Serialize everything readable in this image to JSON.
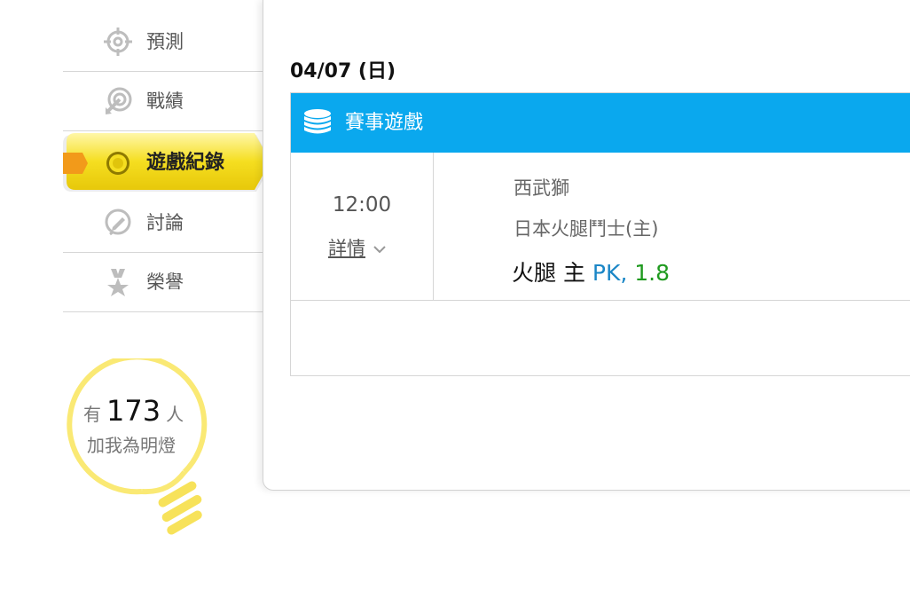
{
  "nav": {
    "items": [
      {
        "label": "預測",
        "icon": "crosshair-icon"
      },
      {
        "label": "戰績",
        "icon": "target-arrow-icon"
      },
      {
        "label": "遊戲紀錄",
        "icon": "ring-icon",
        "active": true
      },
      {
        "label": "討論",
        "icon": "chat-pencil-icon"
      },
      {
        "label": "榮譽",
        "icon": "medal-star-icon"
      }
    ]
  },
  "fans": {
    "prefix": "有",
    "count": "173",
    "suffix": "人",
    "line2": "加我為明燈"
  },
  "main": {
    "date": "04/07 (日)",
    "card": {
      "header": "賽事遊戲",
      "time": "12:00",
      "details": "詳情",
      "team_away": "西武獅",
      "team_home": "日本火腿鬥士(主)",
      "pick_team": "火腿 主",
      "pick_type": "PK,",
      "pick_odds": "1.8"
    }
  },
  "colors": {
    "header_blue": "#0aa8ee",
    "active_yellow": "#f2d716",
    "pk_blue": "#1a86c6",
    "odds_green": "#1f9a1f"
  }
}
